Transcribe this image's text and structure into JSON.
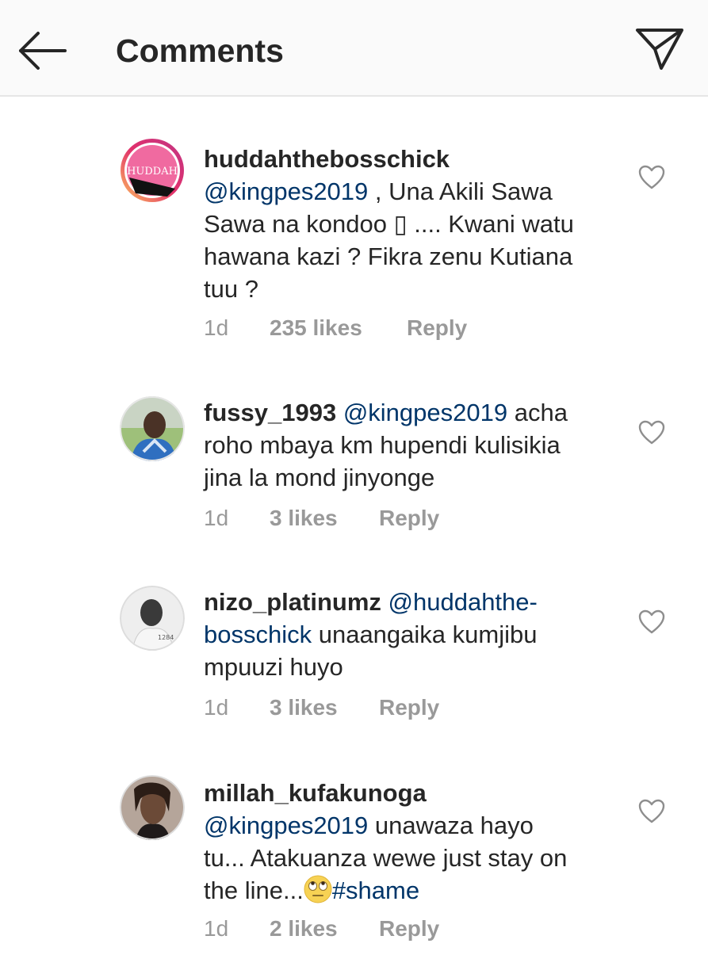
{
  "header": {
    "title": "Comments"
  },
  "comments": [
    {
      "username": "huddahthebosschick",
      "mention": "@kingpes2019",
      "text_line1_after": " , Una Akili Sawa",
      "text_line2": "Sawa na kondoo ▯ .... Kwani watu",
      "text_line3": "hawana kazi ? Fikra zenu Kutiana",
      "text_line4": "tuu ?",
      "avatar_text": "HUDDAH",
      "time": "1d",
      "likes": "235 likes",
      "reply": "Reply"
    },
    {
      "username": "fussy_1993",
      "mention": "@kingpes2019",
      "text_line1_after": " acha",
      "text_line2": "roho mbaya km hupendi kulisikia",
      "text_line3": "jina la mond jinyonge",
      "time": "1d",
      "likes": "3 likes",
      "reply": "Reply"
    },
    {
      "username": "nizo_platinumz",
      "mention_part1": "@huddahthe-",
      "mention_part2": "bosschick",
      "text_line2_after": " unaangaika kumjibu",
      "text_line3": "mpuuzi huyo",
      "time": "1d",
      "likes": "3 likes",
      "reply": "Reply"
    },
    {
      "username": "millah_kufakunoga",
      "mention": "@kingpes2019",
      "text_line2_after": " unawaza hayo",
      "text_line3": "tu... Atakuanza wewe just stay on",
      "text_line4_before": "the line...",
      "hashtag": "#shame",
      "time": "1d",
      "likes": "2 likes",
      "reply": "Reply"
    }
  ]
}
